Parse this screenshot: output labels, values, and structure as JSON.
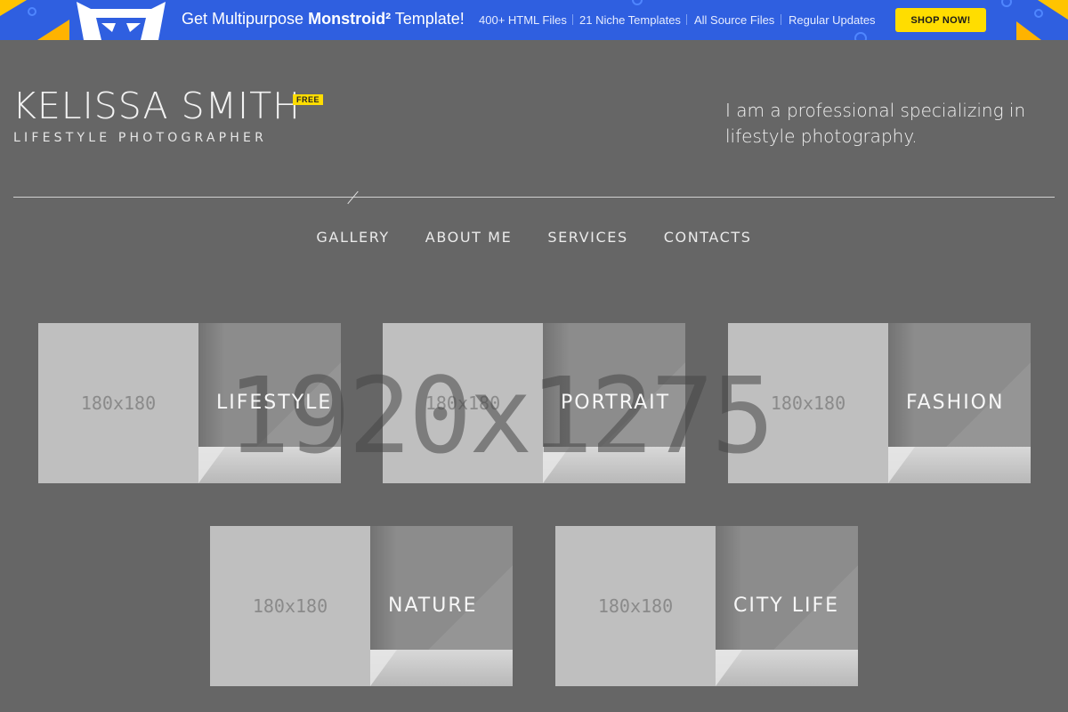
{
  "promo": {
    "title_prefix": "Get Multipurpose ",
    "title_brand": "Monstroid²",
    "title_suffix": " Template!",
    "features": [
      "400+ HTML Files",
      "21 Niche Templates",
      "All Source Files",
      "Regular Updates"
    ],
    "cta": "SHOP NOW!"
  },
  "header": {
    "name": "KELISSA SMITH",
    "badge": "FREE",
    "subtitle": "LIFESTYLE PHOTOGRAPHER",
    "tagline": "I am a professional specializing in lifestyle photography."
  },
  "nav": {
    "items": [
      "GALLERY",
      "ABOUT ME",
      "SERVICES",
      "CONTACTS"
    ]
  },
  "watermark": "1920x1275",
  "gallery": {
    "tiles": [
      {
        "thumb": "180x180",
        "label": "LIFESTYLE"
      },
      {
        "thumb": "180x180",
        "label": "PORTRAIT"
      },
      {
        "thumb": "180x180",
        "label": "FASHION"
      },
      {
        "thumb": "180x180",
        "label": "NATURE"
      },
      {
        "thumb": "180x180",
        "label": "CITY LIFE"
      }
    ]
  },
  "colors": {
    "background": "#666666",
    "promo_bg": "#2f5fe0",
    "accent": "#ffdd00"
  }
}
